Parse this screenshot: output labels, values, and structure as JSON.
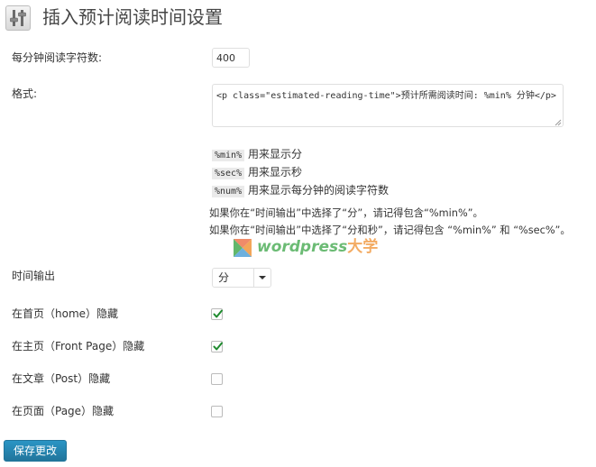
{
  "page": {
    "title": "插入预计阅读时间设置",
    "icon": "settings-icon"
  },
  "fields": {
    "words_per_minute": {
      "label": "每分钟阅读字符数:",
      "value": "400"
    },
    "format": {
      "label": "格式:",
      "value": "<p class=\"estimated-reading-time\">预计所需阅读时间: %min% 分钟</p>"
    },
    "placeholders": [
      {
        "code": "%min%",
        "desc": "用来显示分"
      },
      {
        "code": "%sec%",
        "desc": "用来显示秒"
      },
      {
        "code": "%num%",
        "desc": "用来显示每分钟的阅读字符数"
      }
    ],
    "notes": [
      "如果你在“时间输出”中选择了“分”，请记得包含“%min%”。",
      "如果你在“时间输出”中选择了“分和秒”，请记得包含 “%min%” 和 “%sec%”。"
    ],
    "time_output": {
      "label": "时间输出",
      "selected": "分"
    },
    "hide_home": {
      "label": "在首页（home）隐藏",
      "checked": true
    },
    "hide_front_page": {
      "label": "在主页（Front Page）隐藏",
      "checked": true
    },
    "hide_post": {
      "label": "在文章（Post）隐藏",
      "checked": false
    },
    "hide_page": {
      "label": "在页面（Page）隐藏",
      "checked": false
    }
  },
  "watermark": {
    "latin": "wordpress",
    "cjk": "大学",
    "icon": "wordpress-daxue-logo"
  },
  "actions": {
    "save_label": "保存更改"
  },
  "colors": {
    "primary_button": "#21759b",
    "checkmark": "#1e8a2e",
    "watermark_green": "#3aa546",
    "watermark_orange": "#f09030"
  }
}
